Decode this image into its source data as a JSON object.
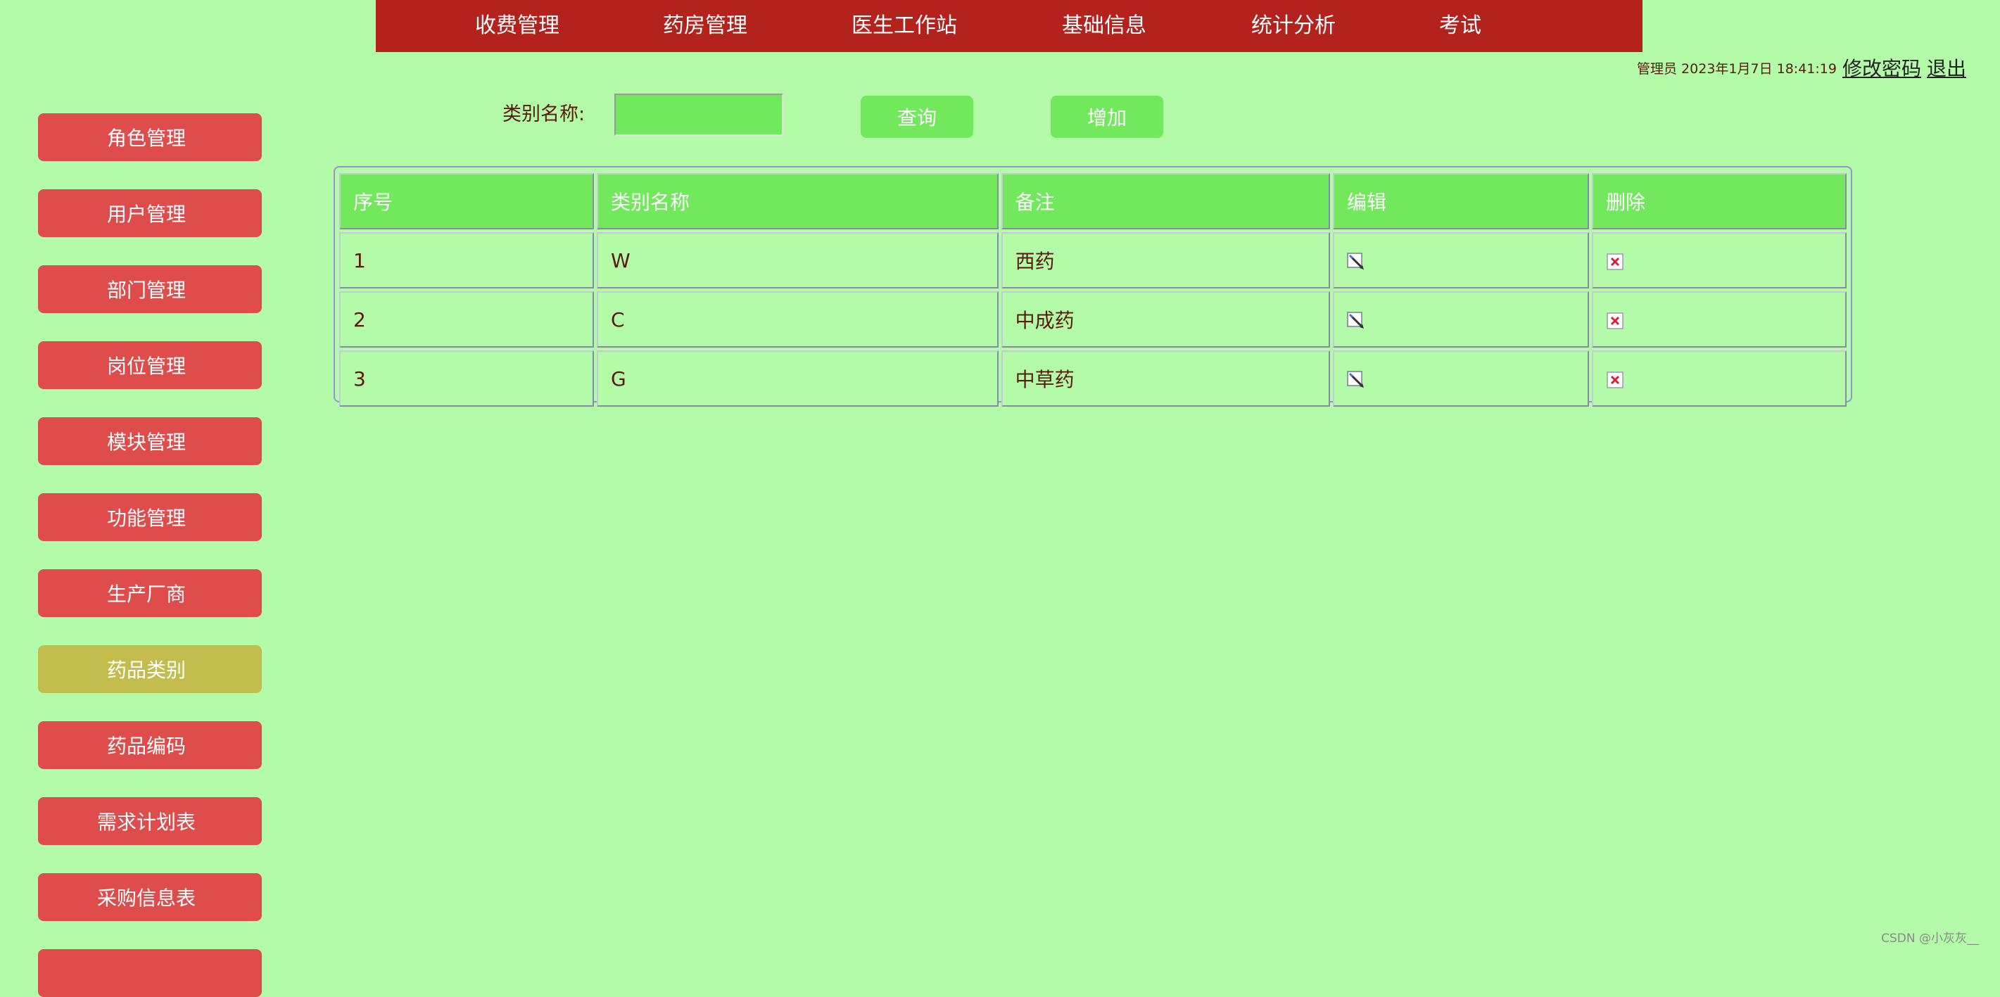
{
  "top_nav": {
    "items": [
      {
        "label": "收费管理"
      },
      {
        "label": "药房管理"
      },
      {
        "label": "医生工作站"
      },
      {
        "label": "基础信息"
      },
      {
        "label": "统计分析"
      },
      {
        "label": "考试"
      }
    ]
  },
  "user_bar": {
    "info": "管理员 2023年1月7日 18:41:19",
    "change_password": "修改密码",
    "logout": "退出"
  },
  "sidebar": {
    "items": [
      {
        "label": "角色管理",
        "active": false
      },
      {
        "label": "用户管理",
        "active": false
      },
      {
        "label": "部门管理",
        "active": false
      },
      {
        "label": "岗位管理",
        "active": false
      },
      {
        "label": "模块管理",
        "active": false
      },
      {
        "label": "功能管理",
        "active": false
      },
      {
        "label": "生产厂商",
        "active": false
      },
      {
        "label": "药品类别",
        "active": true
      },
      {
        "label": "药品编码",
        "active": false
      },
      {
        "label": "需求计划表",
        "active": false
      },
      {
        "label": "采购信息表",
        "active": false
      }
    ]
  },
  "search": {
    "label": "类别名称:",
    "value": "",
    "query_button": "查询",
    "add_button": "增加"
  },
  "table": {
    "headers": [
      "序号",
      "类别名称",
      "备注",
      "编辑",
      "删除"
    ],
    "rows": [
      {
        "index": "1",
        "name": "W",
        "remark": "西药"
      },
      {
        "index": "2",
        "name": "C",
        "remark": "中成药"
      },
      {
        "index": "3",
        "name": "G",
        "remark": "中草药"
      }
    ],
    "edit_icon": "edit-pencil-icon",
    "delete_icon": "delete-x-icon"
  },
  "colors": {
    "background": "#b3fba8",
    "nav_bar": "#b3221d",
    "sidebar_button": "#de4c4c",
    "sidebar_active": "#c2bd4c",
    "accent_green": "#72e85c"
  },
  "watermark": "CSDN @小灰灰__"
}
